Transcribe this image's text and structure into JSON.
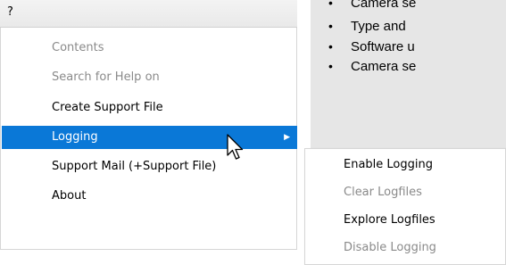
{
  "menubar": {
    "help_label": "?"
  },
  "menu": {
    "items": [
      {
        "label": "Contents",
        "state": "disabled"
      },
      {
        "label": "Search for Help on",
        "state": "disabled"
      },
      {
        "label": "Create Support File",
        "state": "enabled"
      },
      {
        "label": "Logging",
        "state": "selected",
        "submenu": true
      },
      {
        "label": "Support Mail (+Support File)",
        "state": "enabled"
      },
      {
        "label": "About",
        "state": "enabled"
      }
    ],
    "submenu_arrow": "▶"
  },
  "submenu": {
    "items": [
      {
        "label": "Enable Logging",
        "state": "enabled"
      },
      {
        "label": "Clear Logfiles",
        "state": "disabled"
      },
      {
        "label": "Explore Logfiles",
        "state": "enabled"
      },
      {
        "label": "Disable Logging",
        "state": "disabled"
      }
    ]
  },
  "background_document": {
    "bullet": "•",
    "lines": [
      "Camera se",
      "Type and",
      "Software u",
      "Camera se"
    ]
  },
  "colors": {
    "highlight": "#0a78d7",
    "disabled_text": "#8a8a8a",
    "document_background": "#e6e6e6"
  },
  "icons": {
    "cursor": "arrow-pointer-icon"
  }
}
